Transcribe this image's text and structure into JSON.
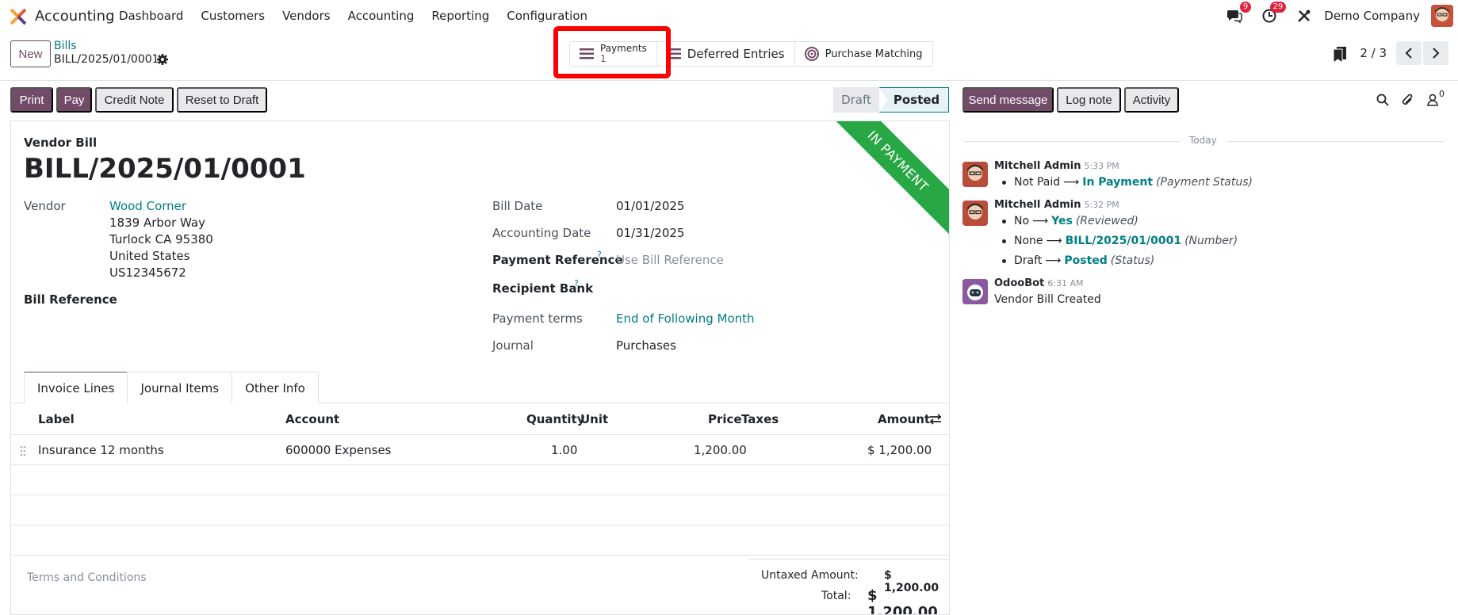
{
  "nav": {
    "app_name": "Accounting",
    "menu": [
      "Dashboard",
      "Customers",
      "Vendors",
      "Accounting",
      "Reporting",
      "Configuration"
    ],
    "messages_badge": "9",
    "activities_badge": "29",
    "company": "Demo Company"
  },
  "control": {
    "new_label": "New",
    "breadcrumb_parent": "Bills",
    "breadcrumb_current": "BILL/2025/01/0001",
    "smart_buttons": {
      "payments_label": "Payments",
      "payments_count": "1",
      "deferred_label": "Deferred Entries",
      "purchase_matching_label": "Purchase Matching"
    },
    "pager": "2 / 3"
  },
  "actions": {
    "print": "Print",
    "pay": "Pay",
    "credit_note": "Credit Note",
    "reset_to_draft": "Reset to Draft",
    "status_draft": "Draft",
    "status_posted": "Posted"
  },
  "form": {
    "ribbon": "IN PAYMENT",
    "doc_type": "Vendor Bill",
    "doc_name": "BILL/2025/01/0001",
    "vendor_label": "Vendor",
    "vendor_name": "Wood Corner",
    "vendor_address": [
      "1839 Arbor Way",
      "Turlock CA 95380",
      "United States",
      "US12345672"
    ],
    "bill_reference_label": "Bill Reference",
    "bill_date_label": "Bill Date",
    "bill_date": "01/01/2025",
    "accounting_date_label": "Accounting Date",
    "accounting_date": "01/31/2025",
    "payment_reference_label": "Payment Reference",
    "payment_reference_placeholder": "Use Bill Reference",
    "recipient_bank_label": "Recipient Bank",
    "payment_terms_label": "Payment terms",
    "payment_terms": "End of Following Month",
    "journal_label": "Journal",
    "journal": "Purchases",
    "help_mark": "?",
    "tabs": [
      "Invoice Lines",
      "Journal Items",
      "Other Info"
    ],
    "columns": {
      "label": "Label",
      "account": "Account",
      "quantity": "Quantity",
      "unit": "Unit",
      "price": "Price",
      "taxes": "Taxes",
      "amount": "Amount"
    },
    "lines": [
      {
        "label": "Insurance 12 months",
        "account": "600000 Expenses",
        "quantity": "1.00",
        "unit": "",
        "price": "1,200.00",
        "taxes": "",
        "amount": "$ 1,200.00"
      }
    ],
    "terms_placeholder": "Terms and Conditions",
    "untaxed_label": "Untaxed Amount:",
    "untaxed_value": "$ 1,200.00",
    "total_label": "Total:",
    "total_value": "$ 1,200.00"
  },
  "chatter": {
    "send_message": "Send message",
    "log_note": "Log note",
    "activity": "Activity",
    "followers_count": "0",
    "today": "Today",
    "messages": [
      {
        "author": "Mitchell Admin",
        "time": "5:33 PM",
        "changes": [
          {
            "old": "Not Paid",
            "new": "In Payment",
            "field": "(Payment Status)"
          }
        ]
      },
      {
        "author": "Mitchell Admin",
        "time": "5:32 PM",
        "changes": [
          {
            "old": "No",
            "new": "Yes",
            "field": "(Reviewed)"
          },
          {
            "old": "None",
            "new": "BILL/2025/01/0001",
            "field": "(Number)"
          },
          {
            "old": "Draft",
            "new": "Posted",
            "field": "(Status)"
          }
        ]
      },
      {
        "author": "OdooBot",
        "time": "6:31 AM",
        "body": "Vendor Bill Created"
      }
    ]
  },
  "colors": {
    "primary": "#714b67",
    "link": "#017e84",
    "ribbon": "#28a745",
    "highlight": "#ff0000",
    "badge": "#e0233f"
  }
}
